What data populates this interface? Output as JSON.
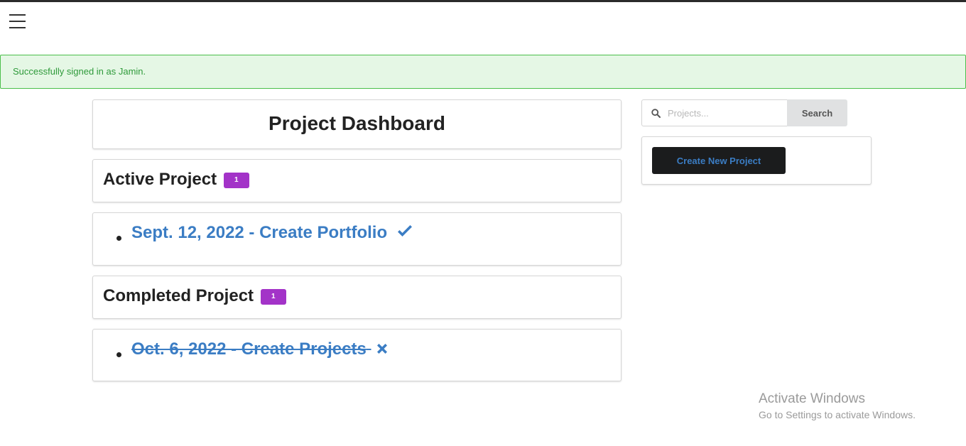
{
  "flash": {
    "message": "Successfully signed in as Jamin."
  },
  "dashboard": {
    "title": "Project Dashboard"
  },
  "active": {
    "heading": "Active Project",
    "count": "1",
    "items": [
      {
        "label": "Sept. 12, 2022 - Create Portfolio",
        "icon": "check-icon"
      }
    ]
  },
  "completed": {
    "heading": "Completed Project",
    "count": "1",
    "items": [
      {
        "label": "Oct. 6, 2022 - Create Projects",
        "icon": "x-icon"
      }
    ]
  },
  "search": {
    "placeholder": "Projects...",
    "button_label": "Search"
  },
  "sidebar": {
    "create_label": "Create New Project"
  },
  "watermark": {
    "title": "Activate Windows",
    "subtitle": "Go to Settings to activate Windows."
  },
  "colors": {
    "accent": "#3b7dc4",
    "badge": "#a333c8",
    "flash_bg": "#e5f7e5",
    "flash_text": "#2e9a3a"
  }
}
